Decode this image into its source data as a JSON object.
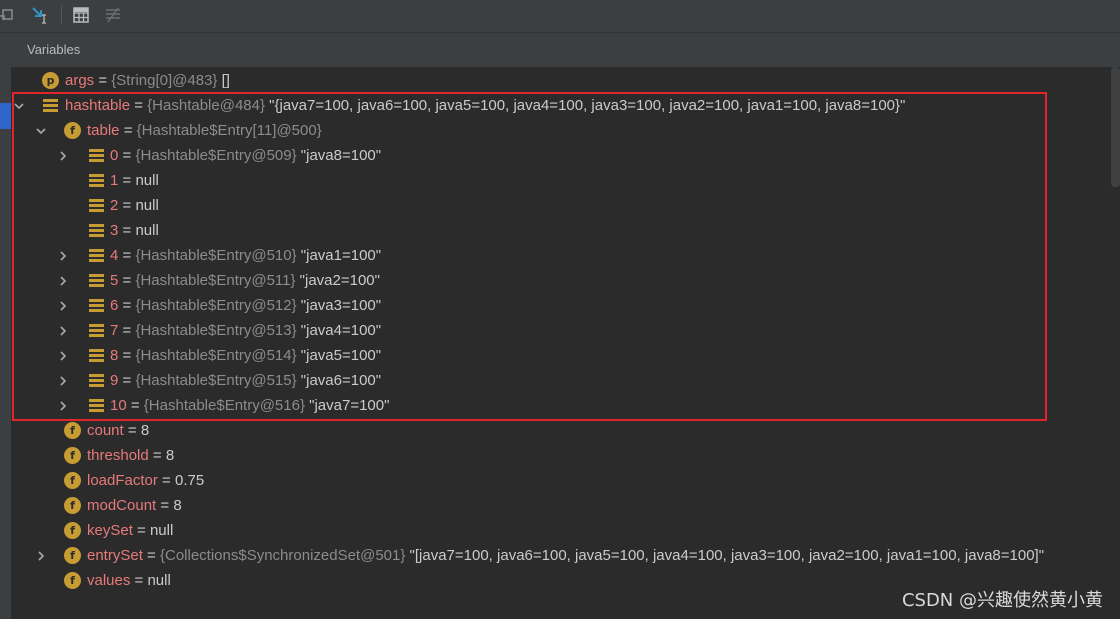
{
  "panel": {
    "title": "Variables"
  },
  "toolbar": {
    "buttons": [
      "restore-layout-icon",
      "step-into-icon",
      "evaluate-table-icon",
      "settings-list-icon"
    ]
  },
  "colors": {
    "highlight_border": "#e0262a",
    "field_icon": "#c69c33",
    "name": "#e77a7a"
  },
  "variables": [
    {
      "name": "args",
      "eq": " = ",
      "type": "{String[0]@483}",
      "value": " []"
    },
    {
      "name": "hashtable",
      "eq": " = ",
      "type": "{Hashtable@484}",
      "value": " \"{java7=100, java6=100, java5=100, java4=100, java3=100, java2=100, java1=100, java8=100}\""
    },
    {
      "name": "table",
      "eq": " = ",
      "type": "{Hashtable$Entry[11]@500}",
      "value": ""
    },
    {
      "name": "0",
      "eq": " = ",
      "type": "{Hashtable$Entry@509}",
      "value": " \"java8=100\""
    },
    {
      "name": "1",
      "eq": " = ",
      "type": "",
      "value": "null"
    },
    {
      "name": "2",
      "eq": " = ",
      "type": "",
      "value": "null"
    },
    {
      "name": "3",
      "eq": " = ",
      "type": "",
      "value": "null"
    },
    {
      "name": "4",
      "eq": " = ",
      "type": "{Hashtable$Entry@510}",
      "value": " \"java1=100\""
    },
    {
      "name": "5",
      "eq": " = ",
      "type": "{Hashtable$Entry@511}",
      "value": " \"java2=100\""
    },
    {
      "name": "6",
      "eq": " = ",
      "type": "{Hashtable$Entry@512}",
      "value": " \"java3=100\""
    },
    {
      "name": "7",
      "eq": " = ",
      "type": "{Hashtable$Entry@513}",
      "value": " \"java4=100\""
    },
    {
      "name": "8",
      "eq": " = ",
      "type": "{Hashtable$Entry@514}",
      "value": " \"java5=100\""
    },
    {
      "name": "9",
      "eq": " = ",
      "type": "{Hashtable$Entry@515}",
      "value": " \"java6=100\""
    },
    {
      "name": "10",
      "eq": " = ",
      "type": "{Hashtable$Entry@516}",
      "value": " \"java7=100\""
    },
    {
      "name": "count",
      "eq": " = ",
      "type": "",
      "value": "8"
    },
    {
      "name": "threshold",
      "eq": " = ",
      "type": "",
      "value": "8"
    },
    {
      "name": "loadFactor",
      "eq": " = ",
      "type": "",
      "value": "0.75"
    },
    {
      "name": "modCount",
      "eq": " = ",
      "type": "",
      "value": "8"
    },
    {
      "name": "keySet",
      "eq": " = ",
      "type": "",
      "value": "null"
    },
    {
      "name": "entrySet",
      "eq": " = ",
      "type": "{Collections$SynchronizedSet@501}",
      "value": " \"[java7=100, java6=100, java5=100, java4=100, java3=100, java2=100, java1=100, java8=100]\""
    },
    {
      "name": "values",
      "eq": " = ",
      "type": "",
      "value": "null"
    }
  ],
  "icons": {
    "param": "p",
    "field": "f"
  },
  "watermark": "CSDN @兴趣使然黄小黄"
}
